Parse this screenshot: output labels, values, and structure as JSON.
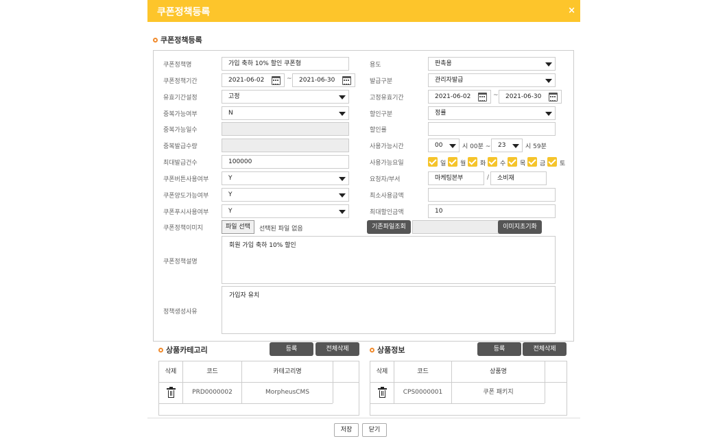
{
  "dialog": {
    "title": "쿠폰정책등록",
    "close": "×"
  },
  "section_title": "쿠폰정책등록",
  "form": {
    "left": {
      "name_label": "쿠폰정책명",
      "name_value": "가입 축하 10% 할인 쿠폰형",
      "period_label": "쿠폰정책기간",
      "period_start": "2021-06-02",
      "period_end": "2021-06-30",
      "validity_label": "유효기간설정",
      "validity_value": "고정",
      "dup_label": "중복가능여부",
      "dup_value": "N",
      "dup_days_label": "중복가능일수",
      "dup_days_value": "",
      "dup_qty_label": "중복발급수량",
      "dup_qty_value": "",
      "max_issue_label": "최대발급건수",
      "max_issue_value": "100000",
      "btn_use_label": "쿠폰버튼사용여부",
      "btn_use_value": "Y",
      "transfer_label": "쿠폰양도가능여부",
      "transfer_value": "Y",
      "push_label": "쿠폰푸시사용여부",
      "push_value": "Y",
      "image_label": "쿠폰정책이미지",
      "file_btn": "파일 선택",
      "file_status": "선택된 파일 없음"
    },
    "right": {
      "usage_label": "용도",
      "usage_value": "판촉용",
      "issue_type_label": "발급구분",
      "issue_type_value": "관리자발급",
      "fixed_period_label": "고정유효기간",
      "fixed_start": "2021-06-02",
      "fixed_end": "2021-06-30",
      "discount_type_label": "할인구분",
      "discount_type_value": "정률",
      "discount_rate_label": "할인률",
      "discount_rate_value": "",
      "time_label": "사용가능시간",
      "time_from": "00",
      "time_from_suffix": "시 00분 ~",
      "time_to": "23",
      "time_to_suffix": "시 59분",
      "days_label": "사용가능요일",
      "days": [
        "일",
        "월",
        "화",
        "수",
        "목",
        "금",
        "토"
      ],
      "requester_label": "요청자/부서",
      "requester_dept": "마케팅본부",
      "requester_sep": "/",
      "requester_name": "소비재",
      "min_amount_label": "최소사용금액",
      "min_amount_value": "",
      "max_discount_label": "최대할인금액",
      "max_discount_value": "10",
      "existing_file_btn": "기존파일조회",
      "reset_image_btn": "이미지초기화"
    },
    "desc_label": "쿠폰정책설명",
    "desc_value": "회원 가입 축하 10% 할인",
    "reason_label": "정책생성사유",
    "reason_value": "가입자 유치"
  },
  "category": {
    "title": "상품카테고리",
    "register_btn": "등록",
    "delete_all_btn": "전체삭제",
    "headers": [
      "삭제",
      "코드",
      "카테고리명"
    ],
    "rows": [
      {
        "code": "PRD0000002",
        "name": "MorpheusCMS"
      }
    ]
  },
  "product": {
    "title": "상품정보",
    "register_btn": "등록",
    "delete_all_btn": "전체삭제",
    "headers": [
      "삭제",
      "코드",
      "상품명"
    ],
    "rows": [
      {
        "code": "CPS0000001",
        "name": "쿠폰 패키지"
      }
    ]
  },
  "footer": {
    "save": "저장",
    "close": "닫기"
  },
  "colors": {
    "header": "#fdc52b",
    "accent_bullet": "#f08a2c",
    "dark_button": "#555555",
    "checkbox": "#f5c42b"
  }
}
